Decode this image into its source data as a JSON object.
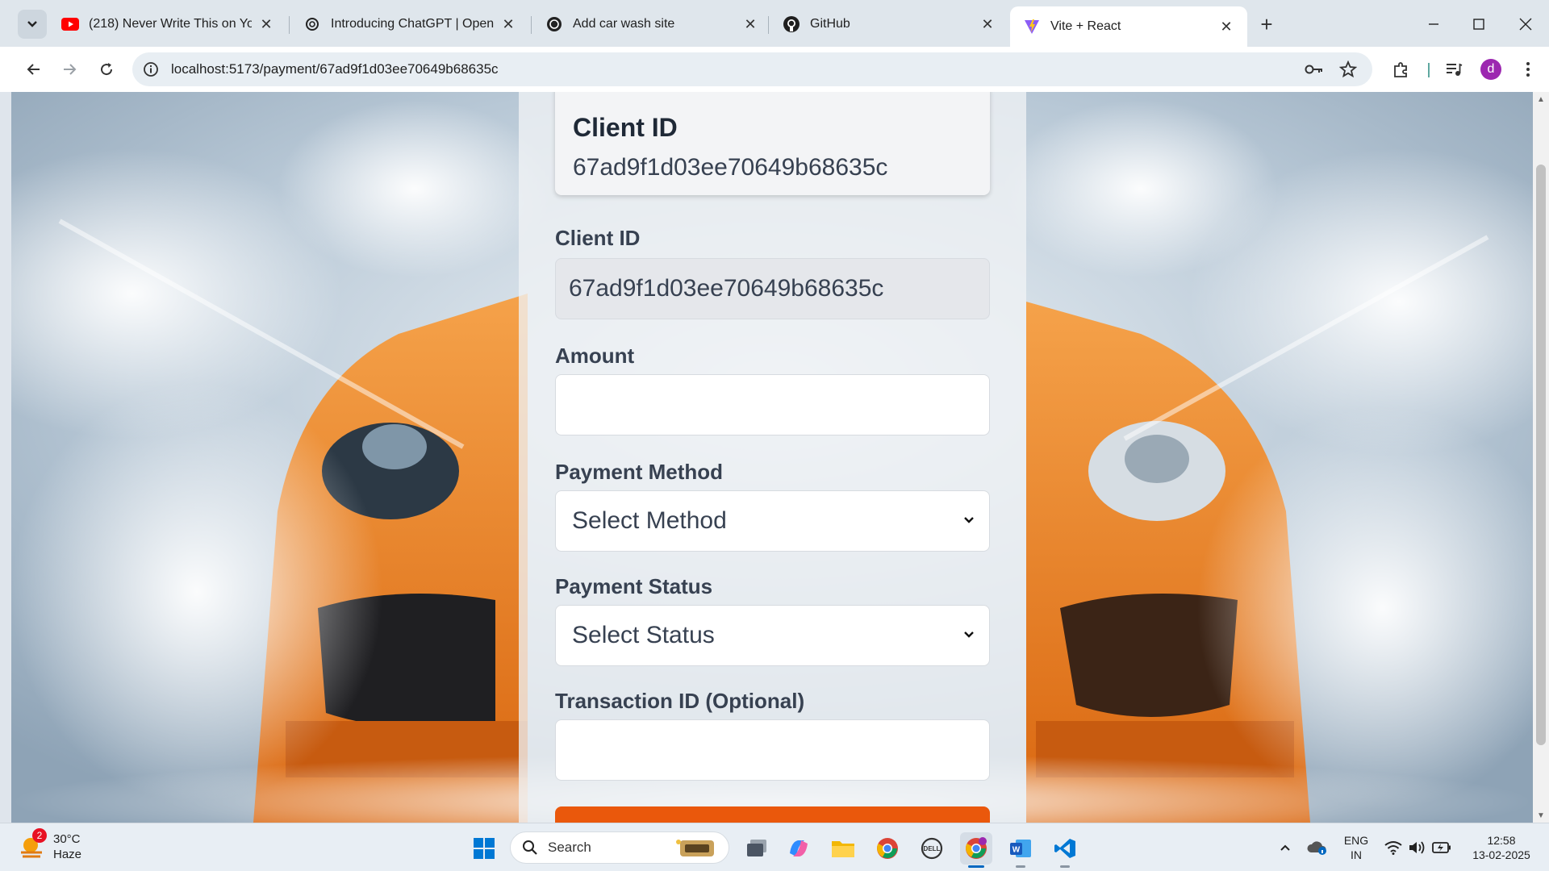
{
  "browser": {
    "tabs": [
      {
        "title": "(218) Never Write This on Your C",
        "favicon": "youtube-icon",
        "active": false
      },
      {
        "title": "Introducing ChatGPT | OpenAI",
        "favicon": "openai-icon",
        "active": false
      },
      {
        "title": "Add car wash site",
        "favicon": "openai-icon",
        "active": false
      },
      {
        "title": "GitHub",
        "favicon": "github-icon",
        "active": false
      },
      {
        "title": "Vite + React",
        "favicon": "vite-icon",
        "active": true
      }
    ],
    "url_host": "localhost",
    "url_rest": ":5173/payment/67ad9f1d03ee70649b68635c",
    "profile_initial": "d"
  },
  "page": {
    "info_card": {
      "label": "Client ID",
      "value": "67ad9f1d03ee70649b68635c"
    },
    "form": {
      "client_id_label": "Client ID",
      "client_id_value": "67ad9f1d03ee70649b68635c",
      "amount_label": "Amount",
      "amount_value": "",
      "payment_method_label": "Payment Method",
      "payment_method_selected": "Select Method",
      "payment_status_label": "Payment Status",
      "payment_status_selected": "Select Status",
      "transaction_id_label": "Transaction ID (Optional)",
      "transaction_id_value": ""
    },
    "colors": {
      "accent": "#ea580c",
      "panel": "#f0f2f5"
    }
  },
  "taskbar": {
    "weather_badge": "2",
    "temperature": "30°C",
    "condition": "Haze",
    "search_placeholder": "Search",
    "language_line1": "ENG",
    "language_line2": "IN",
    "time": "12:58",
    "date": "13-02-2025"
  }
}
